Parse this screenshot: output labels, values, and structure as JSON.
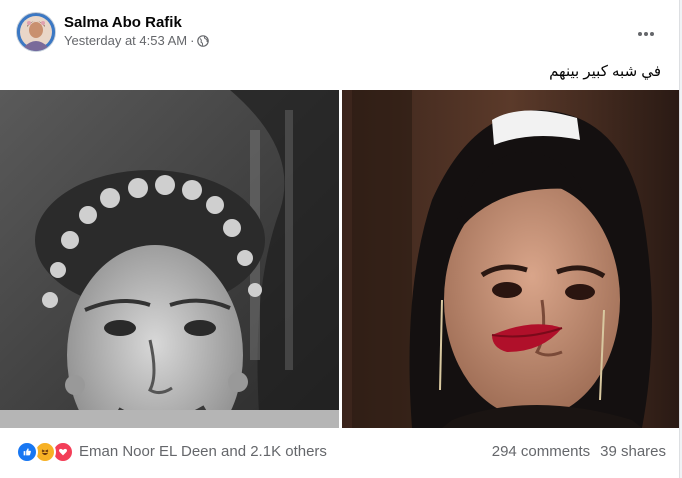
{
  "post": {
    "author": "Salma Abo Rafik",
    "timestamp": "Yesterday at 4:53 AM",
    "separator": "·",
    "audience_icon": "globe-icon",
    "more_icon": "more-horizontal-icon",
    "caption": "في شبه كبير بينهم"
  },
  "photos": [
    {
      "name": "photo-left",
      "style": "black-and-white portrait"
    },
    {
      "name": "photo-right",
      "style": "color portrait"
    }
  ],
  "footer": {
    "reaction_icons": [
      "like-icon",
      "haha-icon",
      "love-icon"
    ],
    "reactors": "Eman Noor EL Deen and 2.1K others",
    "comments": "294 comments",
    "shares": "39 shares"
  },
  "colors": {
    "like": "#1877f2",
    "haha": "#f7b125",
    "love": "#f33e58",
    "secondary_text": "#65676b",
    "primary_text": "#050505"
  }
}
